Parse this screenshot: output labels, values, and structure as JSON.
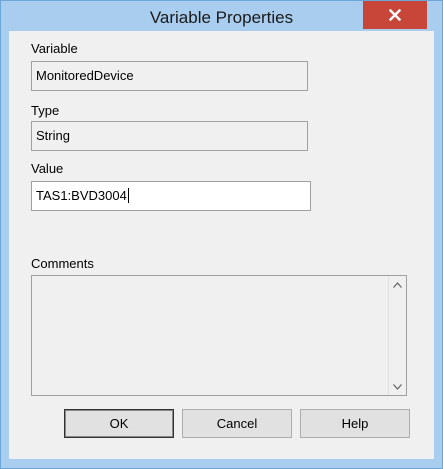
{
  "window": {
    "title": "Variable Properties"
  },
  "fields": {
    "variable": {
      "label": "Variable",
      "value": "MonitoredDevice"
    },
    "type": {
      "label": "Type",
      "value": "String"
    },
    "value": {
      "label": "Value",
      "value": "TAS1:BVD3004"
    },
    "comments": {
      "label": "Comments",
      "value": ""
    }
  },
  "buttons": {
    "ok": "OK",
    "cancel": "Cancel",
    "help": "Help"
  },
  "icons": {
    "close": "close-icon",
    "scroll_up": "chevron-up-icon",
    "scroll_down": "chevron-down-icon"
  },
  "colors": {
    "titlebar": "#a9cdee",
    "close_button": "#c8453a",
    "client": "#f0f0f0"
  }
}
